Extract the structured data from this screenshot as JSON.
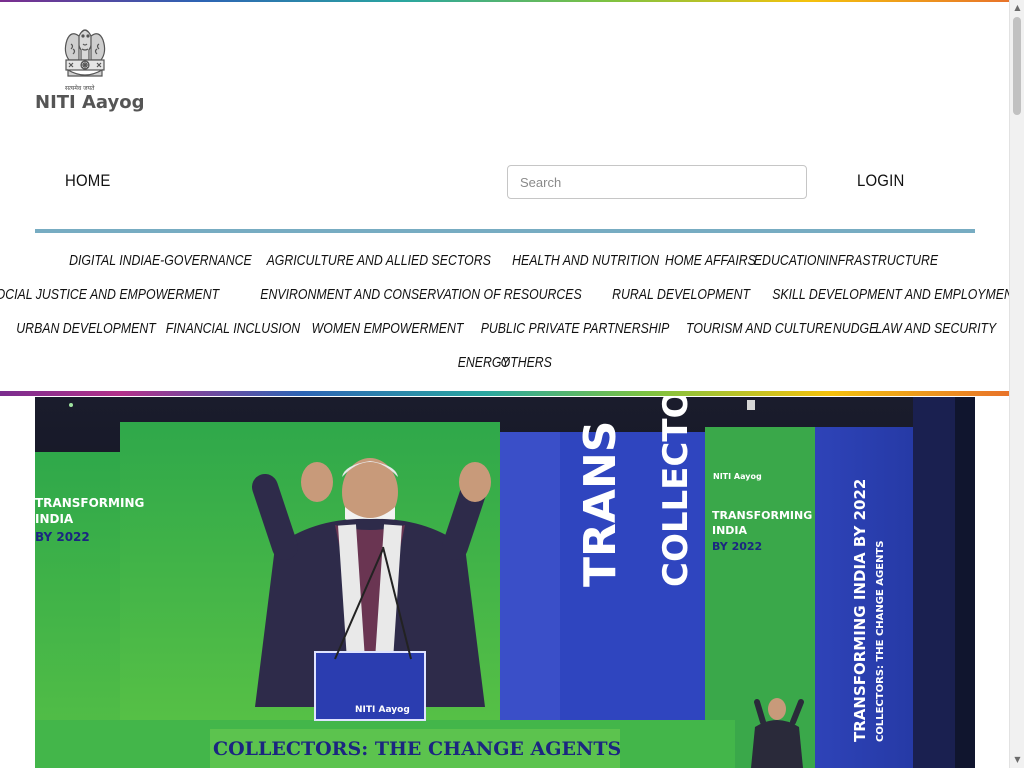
{
  "site": {
    "logo_name": "NITI Aayog",
    "logo_motto": "सत्यमेव जयते"
  },
  "header": {
    "home_label": "HOME",
    "search_placeholder": "Search",
    "login_label": "LOGIN"
  },
  "sectors": {
    "rows": [
      [
        "DIGITAL INDIA",
        "E-GOVERNANCE",
        "AGRICULTURE AND ALLIED SECTORS",
        "HEALTH AND NUTRITION",
        "HOME AFFAIRS",
        "EDUCATION",
        "INFRASTRUCTURE"
      ],
      [
        "SOCIAL JUSTICE AND EMPOWERMENT",
        "ENVIRONMENT AND CONSERVATION OF RESOURCES",
        "RURAL DEVELOPMENT",
        "SKILL DEVELOPMENT AND EMPLOYMENT"
      ],
      [
        "URBAN DEVELOPMENT",
        "FINANCIAL INCLUSION",
        "WOMEN EMPOWERMENT",
        "PUBLIC PRIVATE PARTNERSHIP",
        "TOURISM AND CULTURE",
        "NUDGE",
        "LAW AND SECURITY"
      ],
      [
        "ENERGY",
        "OTHERS"
      ]
    ]
  },
  "hero": {
    "screen_logo": "NITI Aayog",
    "screen_left_line1": "TRANSFORMING",
    "screen_left_line2": "INDIA",
    "screen_left_line3": "BY 2022",
    "banner_vertical_1": "TRANS",
    "banner_vertical_2": "COLLECTO",
    "right_logo": "NITI Aayog",
    "right_line1": "TRANSFORMING",
    "right_line2": "INDIA",
    "right_line3": "BY 2022",
    "side_banner_1": "TRANSFORMING INDIA BY 2022",
    "side_banner_2": "COLLECTORS: THE CHANGE AGENTS",
    "podium_logo": "NITI Aayog",
    "bottom_caption": "COLLECTORS: THE CHANGE AGENTS"
  },
  "colors": {
    "nav_rule": "#77acc2",
    "screen_green": "#43b64a",
    "screen_blue": "#2a3fb0",
    "stage_dark": "#0d0f1e"
  },
  "icons": {
    "scroll_up": "scroll-up-arrow-icon",
    "scroll_down": "scroll-down-arrow-icon"
  }
}
